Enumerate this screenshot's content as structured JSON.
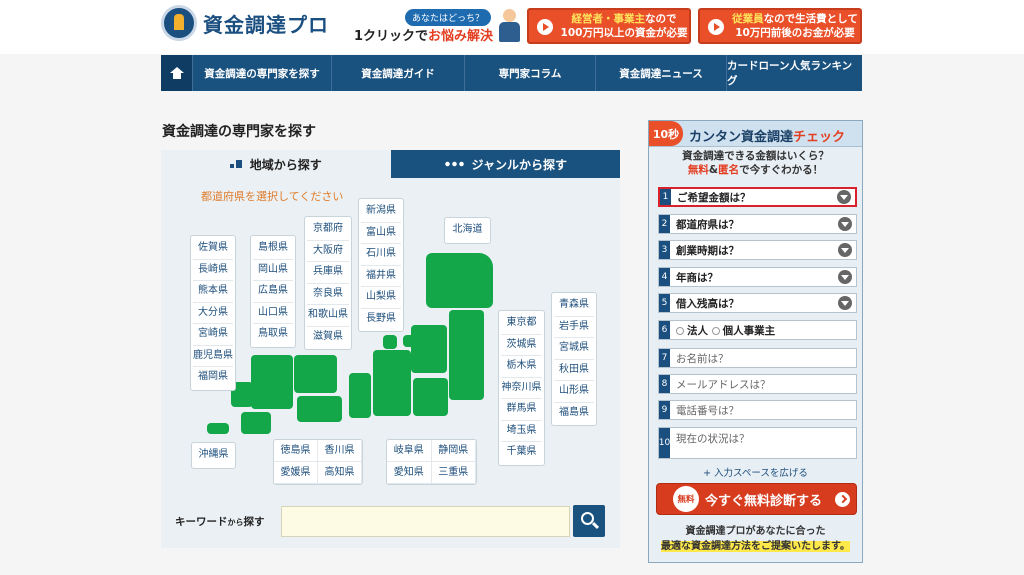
{
  "header": {
    "logo": "資金調達プロ",
    "tag": "あなたはどっち？",
    "oneclick_a": "1クリックで",
    "oneclick_b": "お悩み解決",
    "banner1": {
      "line1_a": "経営者・事業主",
      "line1_b": "なので",
      "line2": "100万円以上の資金が必要"
    },
    "banner2": {
      "line1_a": "従業員",
      "line1_b": "なので生活費として",
      "line2": "10万円前後のお金が必要"
    }
  },
  "nav": {
    "items": [
      "資金調達の専門家を探す",
      "資金調達ガイド",
      "専門家コラム",
      "資金調達ニュース",
      "カードローン人気ランキング"
    ]
  },
  "main": {
    "title": "資金調達の専門家を探す",
    "tab_region": "地域から探す",
    "tab_genre": "ジャンルから探す",
    "prompt": "都道府県を選択してください",
    "kyushu": [
      "佐賀県",
      "長崎県",
      "熊本県",
      "大分県",
      "宮崎県",
      "鹿児島県",
      "福岡県"
    ],
    "chugoku": [
      "島根県",
      "岡山県",
      "広島県",
      "山口県",
      "鳥取県"
    ],
    "kinki": [
      "京都府",
      "大阪府",
      "兵庫県",
      "奈良県",
      "和歌山県",
      "滋賀県"
    ],
    "hokuriku": [
      "新潟県",
      "富山県",
      "石川県",
      "福井県",
      "山梨県",
      "長野県"
    ],
    "hokkaido": "北海道",
    "kanto": [
      "東京都",
      "茨城県",
      "栃木県",
      "神奈川県",
      "群馬県",
      "埼玉県",
      "千葉県"
    ],
    "tohoku": [
      "青森県",
      "岩手県",
      "宮城県",
      "秋田県",
      "山形県",
      "福島県"
    ],
    "okinawa": "沖縄県",
    "shikoku": [
      "徳島県",
      "香川県",
      "愛媛県",
      "高知県"
    ],
    "tokai": [
      "岐阜県",
      "静岡県",
      "愛知県",
      "三重県"
    ],
    "keyword_label": "キーワード",
    "keyword_small": "から",
    "keyword_label2": "探す",
    "keyword_placeholder": ""
  },
  "side": {
    "badge": "10秒",
    "title": "カンタン資金調達",
    "title_red": "チェック",
    "sub1": "資金調達できる金額はいくら？",
    "sub2_red1": "無料",
    "sub2_mid": "&",
    "sub2_red2": "匿名",
    "sub2_rest": "で今すぐわかる！",
    "fields": [
      {
        "num": "1",
        "label": "ご希望金額は？"
      },
      {
        "num": "2",
        "label": "都道府県は？"
      },
      {
        "num": "3",
        "label": "創業時期は？"
      },
      {
        "num": "4",
        "label": "年商は？"
      },
      {
        "num": "5",
        "label": "借入残高は？"
      }
    ],
    "radio": {
      "num": "6",
      "opt1": "法人",
      "opt2": "個人事業主"
    },
    "inputs": [
      {
        "num": "7",
        "ph": "お名前は？"
      },
      {
        "num": "8",
        "ph": "メールアドレスは？"
      },
      {
        "num": "9",
        "ph": "電話番号は？"
      },
      {
        "num": "10",
        "ph": "現在の状況は？"
      }
    ],
    "expand": "+ 入力スペースを広げる",
    "cta_free": "無料",
    "cta": "今すぐ無料診断する",
    "foot1": "資金調達プロがあなたに合った",
    "foot2": "最適な資金調達方法をご提案いたします。",
    "accent": "#e9502a",
    "navy": "#19517f",
    "map_green": "#13a749"
  }
}
